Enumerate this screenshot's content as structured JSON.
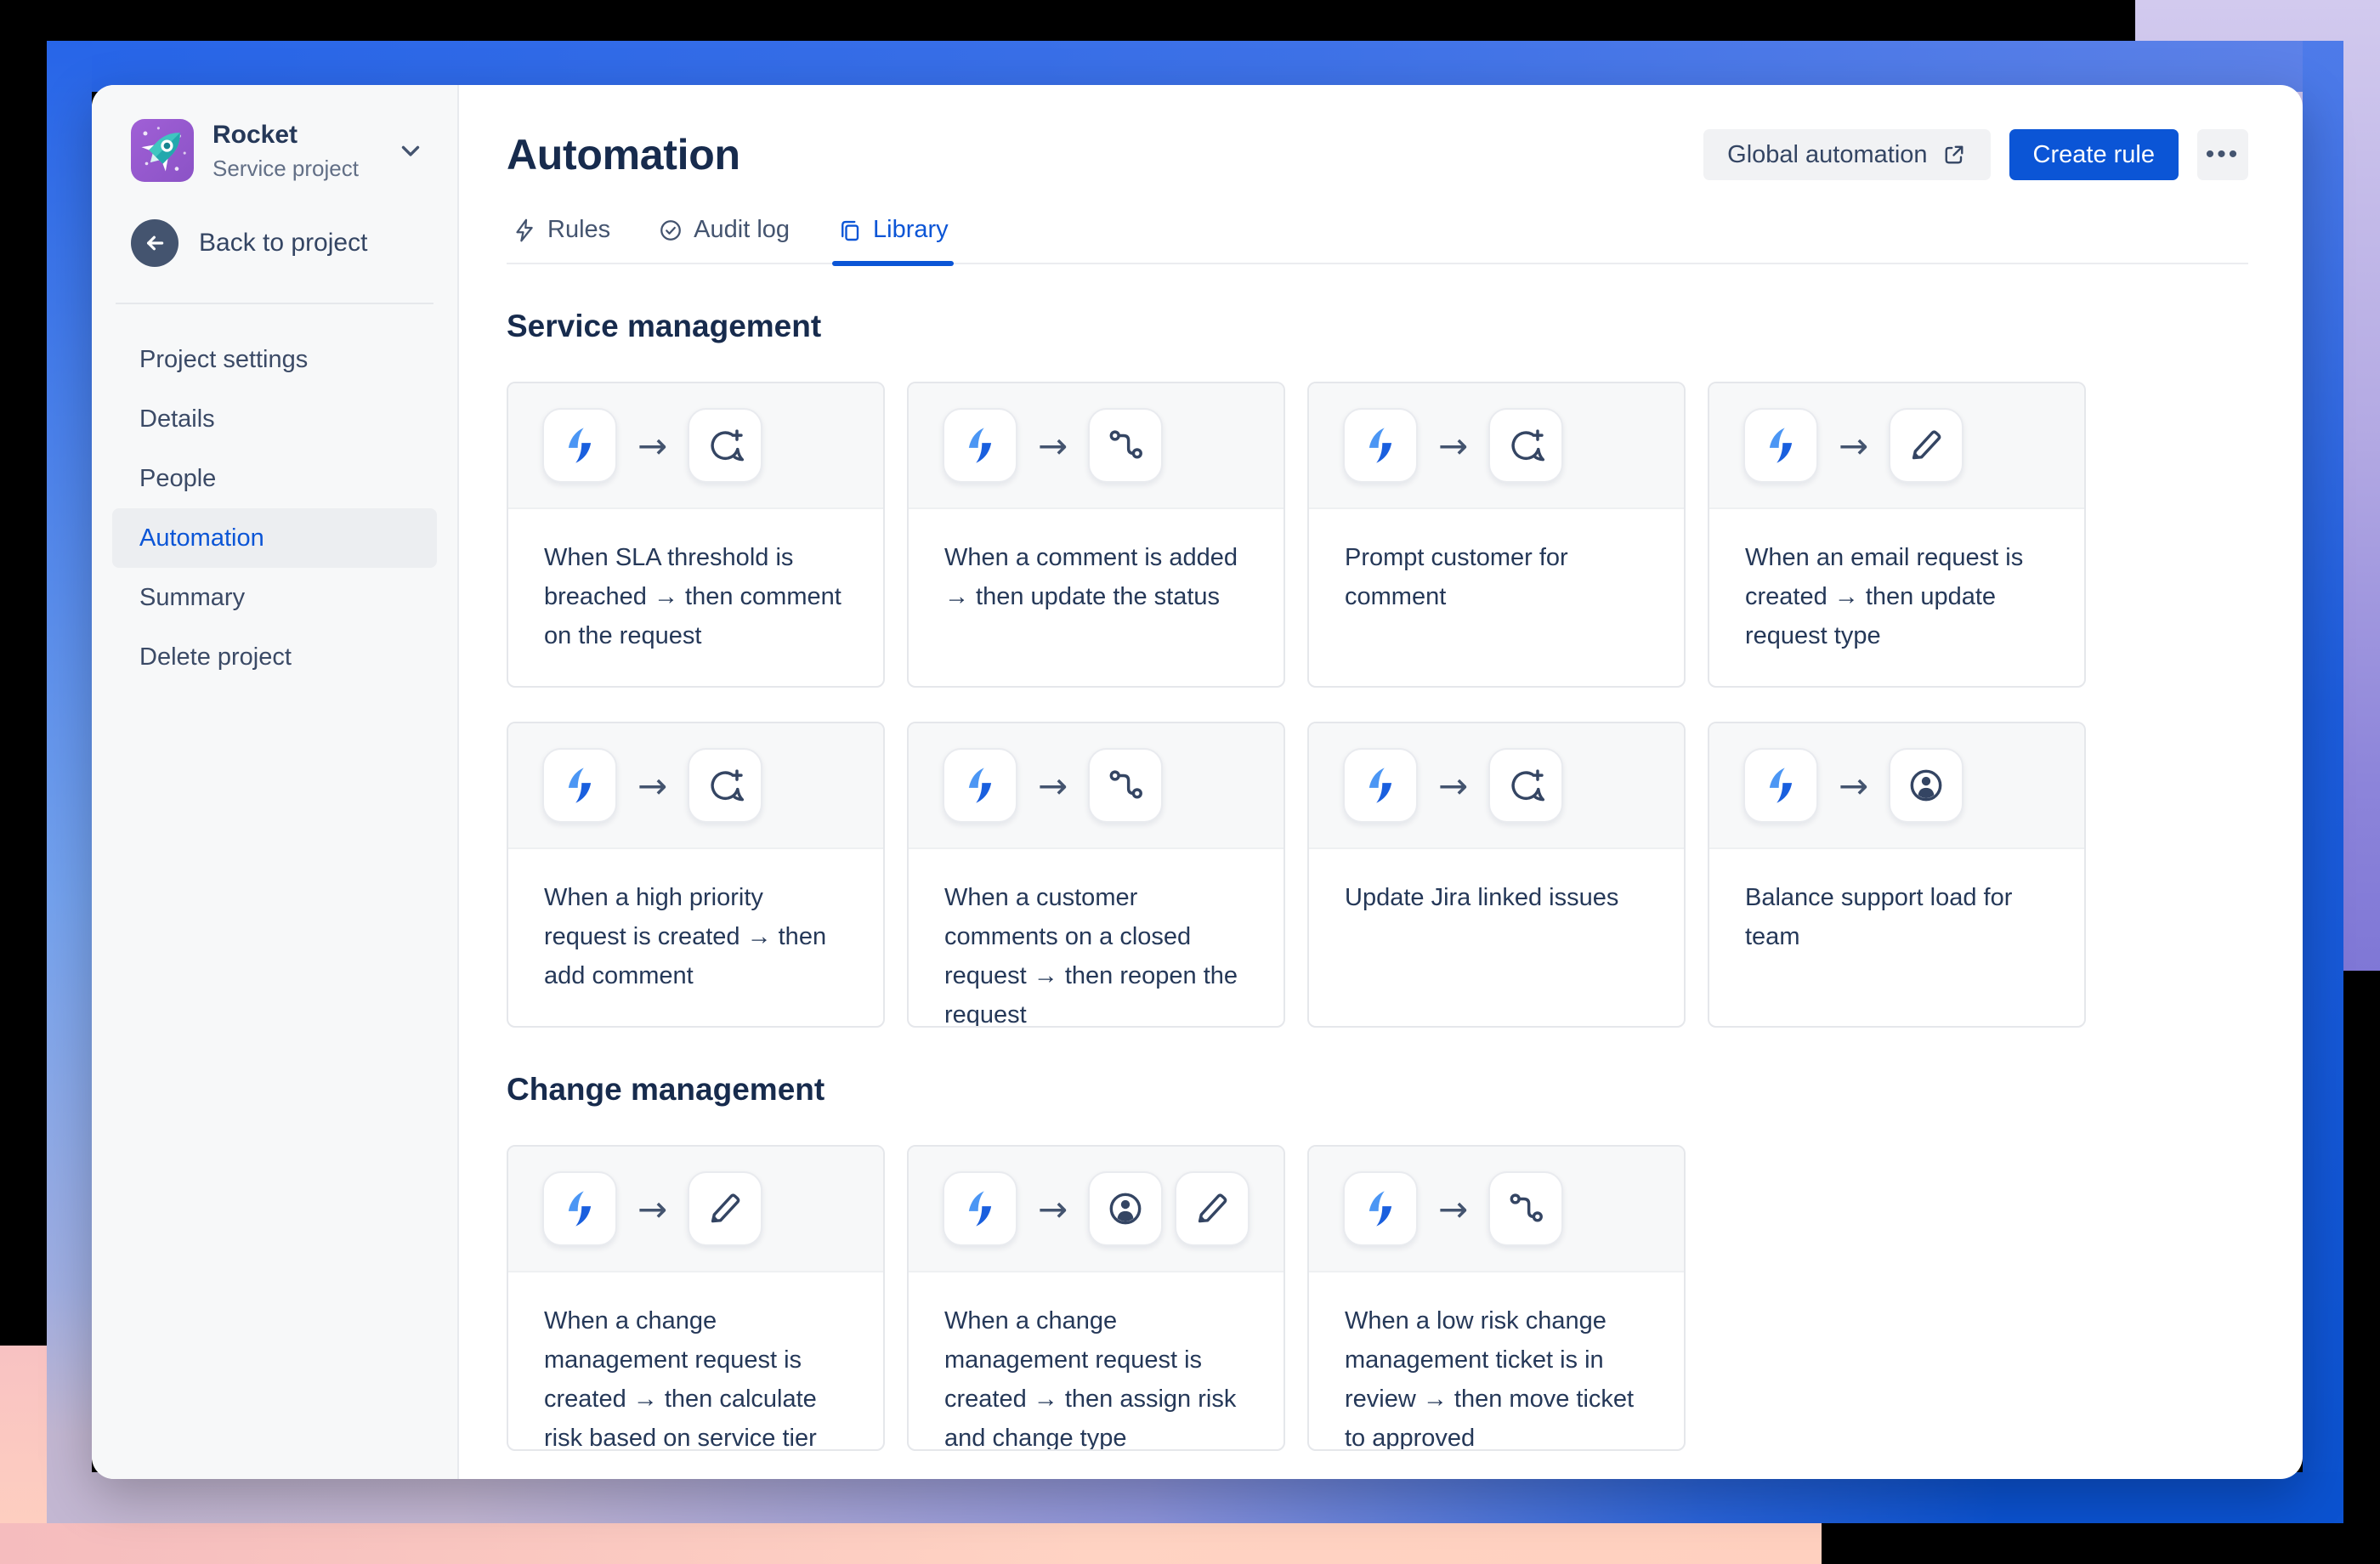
{
  "sidebar": {
    "project_name": "Rocket",
    "project_type": "Service project",
    "back_label": "Back to project",
    "items": [
      {
        "label": "Project settings"
      },
      {
        "label": "Details"
      },
      {
        "label": "People"
      },
      {
        "label": "Automation"
      },
      {
        "label": "Summary"
      },
      {
        "label": "Delete project"
      }
    ],
    "selected_item": "Automation"
  },
  "header": {
    "title": "Automation",
    "global_automation_label": "Global automation",
    "create_rule_label": "Create rule",
    "more_label": "•••"
  },
  "tabs": [
    {
      "label": "Rules",
      "icon": "lightning-outline-icon",
      "active": false
    },
    {
      "label": "Audit log",
      "icon": "check-circle-icon",
      "active": false
    },
    {
      "label": "Library",
      "icon": "copy-pages-icon",
      "active": true
    }
  ],
  "tile_arrow": "→",
  "sections": [
    {
      "title": "Service management",
      "cards": [
        {
          "icons": [
            "automation-lightning",
            "comment-add"
          ],
          "text": "When SLA threshold is breached → then comment on the request"
        },
        {
          "icons": [
            "automation-lightning",
            "workflow-transition"
          ],
          "text": "When a comment is added → then update the status"
        },
        {
          "icons": [
            "automation-lightning",
            "comment-add"
          ],
          "text": "Prompt customer for comment"
        },
        {
          "icons": [
            "automation-lightning",
            "edit-pencil"
          ],
          "text": "When an email request is created → then update request type"
        },
        {
          "icons": [
            "automation-lightning",
            "comment-add"
          ],
          "text": "When a high priority request is created → then add comment"
        },
        {
          "icons": [
            "automation-lightning",
            "workflow-transition"
          ],
          "text": "When a customer comments on a closed request → then reopen the request"
        },
        {
          "icons": [
            "automation-lightning",
            "comment-add"
          ],
          "text": "Update Jira linked issues"
        },
        {
          "icons": [
            "automation-lightning",
            "person-circle"
          ],
          "text": "Balance support load for team"
        }
      ]
    },
    {
      "title": "Change management",
      "cards": [
        {
          "icons": [
            "automation-lightning",
            "edit-pencil"
          ],
          "text": "When a change management request is created → then calculate risk based on service tier"
        },
        {
          "icons": [
            "automation-lightning",
            "person-circle",
            "edit-pencil"
          ],
          "text": "When a change management request is created → then assign risk and change type"
        },
        {
          "icons": [
            "automation-lightning",
            "workflow-transition"
          ],
          "text": "When a low risk change management ticket is in review → then move ticket to approved"
        }
      ]
    }
  ],
  "colors": {
    "primary_blue": "#0b55d6",
    "text_navy": "#172b4d",
    "text_slate": "#44546f",
    "avatar_purple": "#9c59ce",
    "backdrop_purple": "#8d85da",
    "backdrop_blue_frame": "#2765e8",
    "backdrop_peach": "#ffd1c0",
    "backdrop_black": "#000000"
  }
}
